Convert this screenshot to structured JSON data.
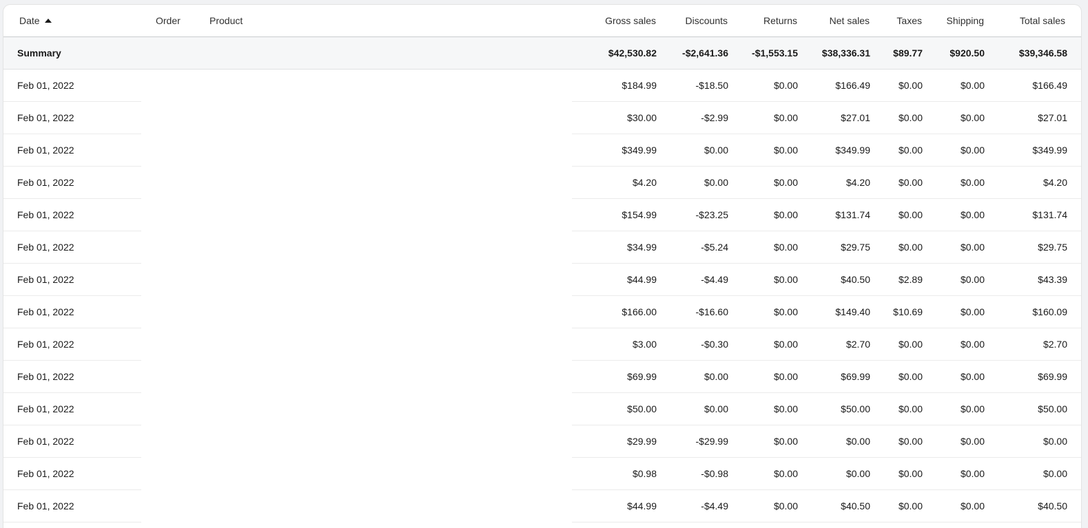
{
  "table": {
    "columns": {
      "date": "Date",
      "order": "Order",
      "product": "Product",
      "gross": "Gross sales",
      "discounts": "Discounts",
      "returns": "Returns",
      "net": "Net sales",
      "taxes": "Taxes",
      "shipping": "Shipping",
      "total": "Total sales"
    },
    "sort": {
      "column": "date",
      "direction": "ascending",
      "icon": "caret-up-icon"
    },
    "summary": {
      "label": "Summary",
      "gross": "$42,530.82",
      "discounts": "-$2,641.36",
      "returns": "-$1,553.15",
      "net": "$38,336.31",
      "taxes": "$89.77",
      "shipping": "$920.50",
      "total": "$39,346.58"
    },
    "rows": [
      {
        "date": "Feb 01, 2022",
        "order": "",
        "product": "",
        "gross": "$184.99",
        "discounts": "-$18.50",
        "returns": "$0.00",
        "net": "$166.49",
        "taxes": "$0.00",
        "shipping": "$0.00",
        "total": "$166.49"
      },
      {
        "date": "Feb 01, 2022",
        "order": "",
        "product": "",
        "gross": "$30.00",
        "discounts": "-$2.99",
        "returns": "$0.00",
        "net": "$27.01",
        "taxes": "$0.00",
        "shipping": "$0.00",
        "total": "$27.01"
      },
      {
        "date": "Feb 01, 2022",
        "order": "",
        "product": "",
        "gross": "$349.99",
        "discounts": "$0.00",
        "returns": "$0.00",
        "net": "$349.99",
        "taxes": "$0.00",
        "shipping": "$0.00",
        "total": "$349.99"
      },
      {
        "date": "Feb 01, 2022",
        "order": "",
        "product": "",
        "gross": "$4.20",
        "discounts": "$0.00",
        "returns": "$0.00",
        "net": "$4.20",
        "taxes": "$0.00",
        "shipping": "$0.00",
        "total": "$4.20"
      },
      {
        "date": "Feb 01, 2022",
        "order": "",
        "product": "",
        "gross": "$154.99",
        "discounts": "-$23.25",
        "returns": "$0.00",
        "net": "$131.74",
        "taxes": "$0.00",
        "shipping": "$0.00",
        "total": "$131.74"
      },
      {
        "date": "Feb 01, 2022",
        "order": "",
        "product": "",
        "gross": "$34.99",
        "discounts": "-$5.24",
        "returns": "$0.00",
        "net": "$29.75",
        "taxes": "$0.00",
        "shipping": "$0.00",
        "total": "$29.75"
      },
      {
        "date": "Feb 01, 2022",
        "order": "",
        "product": "",
        "gross": "$44.99",
        "discounts": "-$4.49",
        "returns": "$0.00",
        "net": "$40.50",
        "taxes": "$2.89",
        "shipping": "$0.00",
        "total": "$43.39"
      },
      {
        "date": "Feb 01, 2022",
        "order": "",
        "product": "",
        "gross": "$166.00",
        "discounts": "-$16.60",
        "returns": "$0.00",
        "net": "$149.40",
        "taxes": "$10.69",
        "shipping": "$0.00",
        "total": "$160.09"
      },
      {
        "date": "Feb 01, 2022",
        "order": "",
        "product": "",
        "gross": "$3.00",
        "discounts": "-$0.30",
        "returns": "$0.00",
        "net": "$2.70",
        "taxes": "$0.00",
        "shipping": "$0.00",
        "total": "$2.70"
      },
      {
        "date": "Feb 01, 2022",
        "order": "",
        "product": "",
        "gross": "$69.99",
        "discounts": "$0.00",
        "returns": "$0.00",
        "net": "$69.99",
        "taxes": "$0.00",
        "shipping": "$0.00",
        "total": "$69.99"
      },
      {
        "date": "Feb 01, 2022",
        "order": "",
        "product": "",
        "gross": "$50.00",
        "discounts": "$0.00",
        "returns": "$0.00",
        "net": "$50.00",
        "taxes": "$0.00",
        "shipping": "$0.00",
        "total": "$50.00"
      },
      {
        "date": "Feb 01, 2022",
        "order": "",
        "product": "",
        "gross": "$29.99",
        "discounts": "-$29.99",
        "returns": "$0.00",
        "net": "$0.00",
        "taxes": "$0.00",
        "shipping": "$0.00",
        "total": "$0.00"
      },
      {
        "date": "Feb 01, 2022",
        "order": "",
        "product": "",
        "gross": "$0.98",
        "discounts": "-$0.98",
        "returns": "$0.00",
        "net": "$0.00",
        "taxes": "$0.00",
        "shipping": "$0.00",
        "total": "$0.00"
      },
      {
        "date": "Feb 01, 2022",
        "order": "",
        "product": "",
        "gross": "$44.99",
        "discounts": "-$4.49",
        "returns": "$0.00",
        "net": "$40.50",
        "taxes": "$0.00",
        "shipping": "$0.00",
        "total": "$40.50"
      }
    ]
  }
}
